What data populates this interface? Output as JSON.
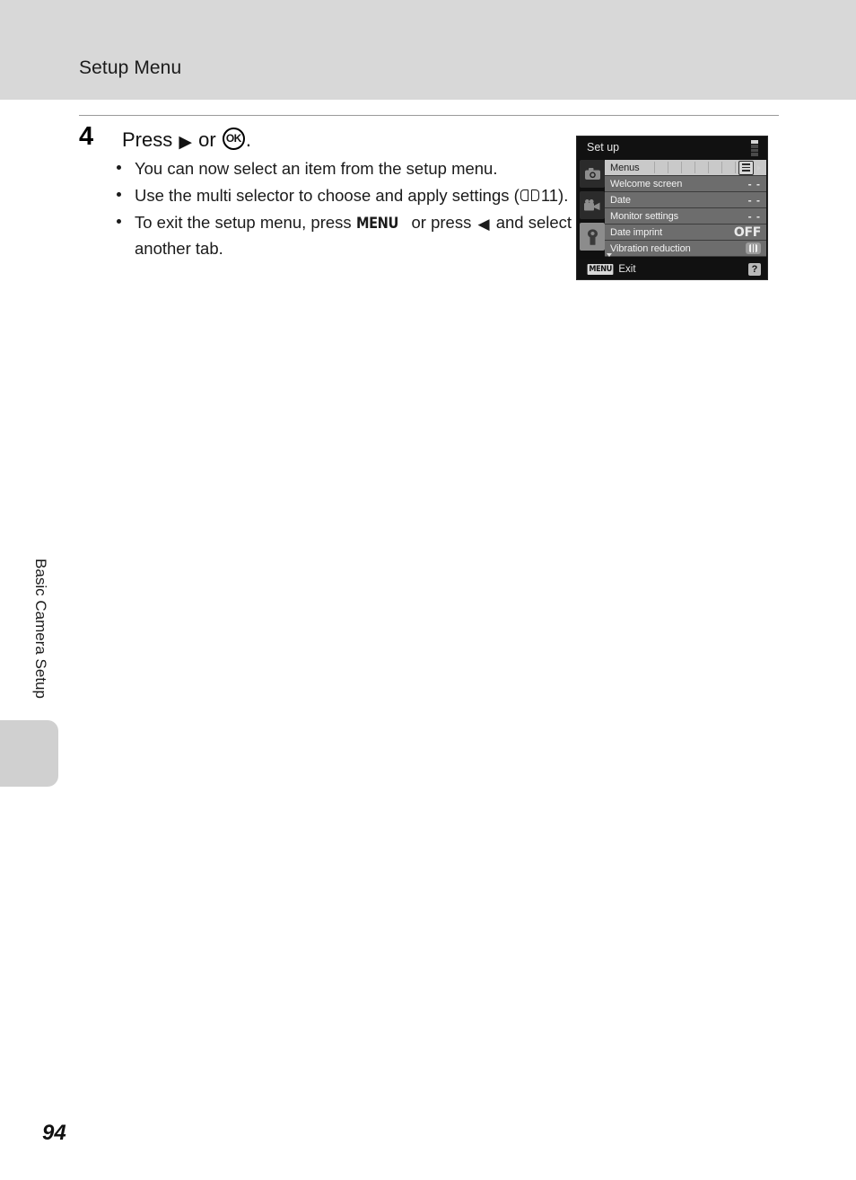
{
  "header": {
    "title": "Setup Menu"
  },
  "step": {
    "number": "4",
    "heading_prefix": "Press",
    "heading_or": "or",
    "heading_suffix": ".",
    "right_icon": "right-triangle-icon",
    "ok_icon": "ok-button-icon"
  },
  "bullets": [
    {
      "id": "bullet-select-item",
      "text": "You can now select an item from the setup menu."
    },
    {
      "id": "bullet-multi-selector",
      "text_before": "Use the multi selector to choose and apply settings",
      "ref_open": "(",
      "ref_icon": "book-icon",
      "ref_page": "11",
      "ref_close": ")."
    },
    {
      "id": "bullet-exit",
      "text_before": "To exit the setup menu, press",
      "menu_button": "MENU",
      "text_middle": "or press",
      "left_icon": "left-triangle-icon",
      "text_after": "and select another tab."
    }
  ],
  "side": {
    "running_head": "Basic Camera Setup"
  },
  "page": {
    "number": "94"
  },
  "lcd": {
    "title": "Set up",
    "scroll_segments": 4,
    "scroll_active_index": 0,
    "tabs": [
      {
        "name": "shooting-mode-tab",
        "icon": "camera-icon",
        "active": false
      },
      {
        "name": "movie-mode-tab",
        "icon": "movie-camera-icon",
        "active": false
      },
      {
        "name": "setup-mode-tab",
        "icon": "wrench-icon",
        "active": true
      }
    ],
    "rows": [
      {
        "label": "Menus",
        "value_type": "list-icon",
        "value": "",
        "selected": true,
        "has_ticks": true,
        "has_caret": true
      },
      {
        "label": "Welcome screen",
        "value_type": "dashes",
        "value": "- -",
        "selected": false
      },
      {
        "label": "Date",
        "value_type": "dashes",
        "value": "- -",
        "selected": false
      },
      {
        "label": "Monitor settings",
        "value_type": "dashes",
        "value": "- -",
        "selected": false
      },
      {
        "label": "Date imprint",
        "value_type": "text",
        "value": "OFF",
        "selected": false
      },
      {
        "label": "Vibration reduction",
        "value_type": "vr-icon",
        "value": "",
        "selected": false
      }
    ],
    "bottom": {
      "menu_chip": "MENU",
      "exit_label": "Exit",
      "help_icon": "?"
    }
  },
  "colors": {
    "header_band": "#d8d8d8",
    "side_tab": "#d0d0d0",
    "lcd_background": "#101010",
    "lcd_row": "#6d6d6d",
    "lcd_row_selected": "#c9c9c9",
    "rule": "#9b9b9b"
  }
}
